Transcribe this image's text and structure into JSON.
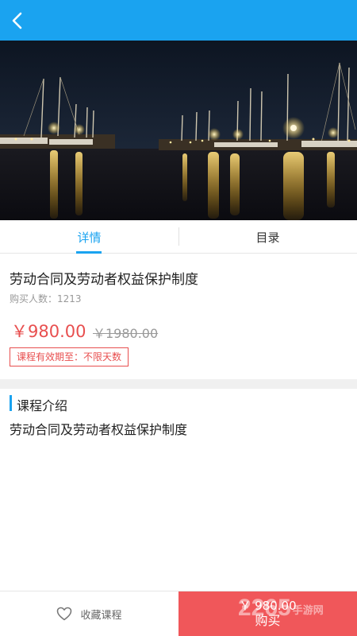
{
  "nav": {
    "back_icon": "chevron-left-icon"
  },
  "tabs": [
    {
      "label": "详情",
      "active": true
    },
    {
      "label": "目录",
      "active": false
    }
  ],
  "course": {
    "title": "劳动合同及劳动者权益保护制度",
    "buyers": "购买人数：1213",
    "price": "￥980.00",
    "original_price": "￥1980.00",
    "validity": "课程有效期至：不限天数"
  },
  "intro": {
    "heading": "课程介绍",
    "text": "劳动合同及劳动者权益保护制度"
  },
  "bottom": {
    "favorite_label": "收藏课程",
    "favorite_icon": "heart-outline-icon",
    "buy_price": "￥ 980.00",
    "buy_label": "购买"
  },
  "watermark": {
    "text": "2265",
    "sub": "手游网"
  },
  "colors": {
    "primary": "#1aa3f0",
    "price": "#e84f4f",
    "buy_bg": "#f0575a"
  }
}
